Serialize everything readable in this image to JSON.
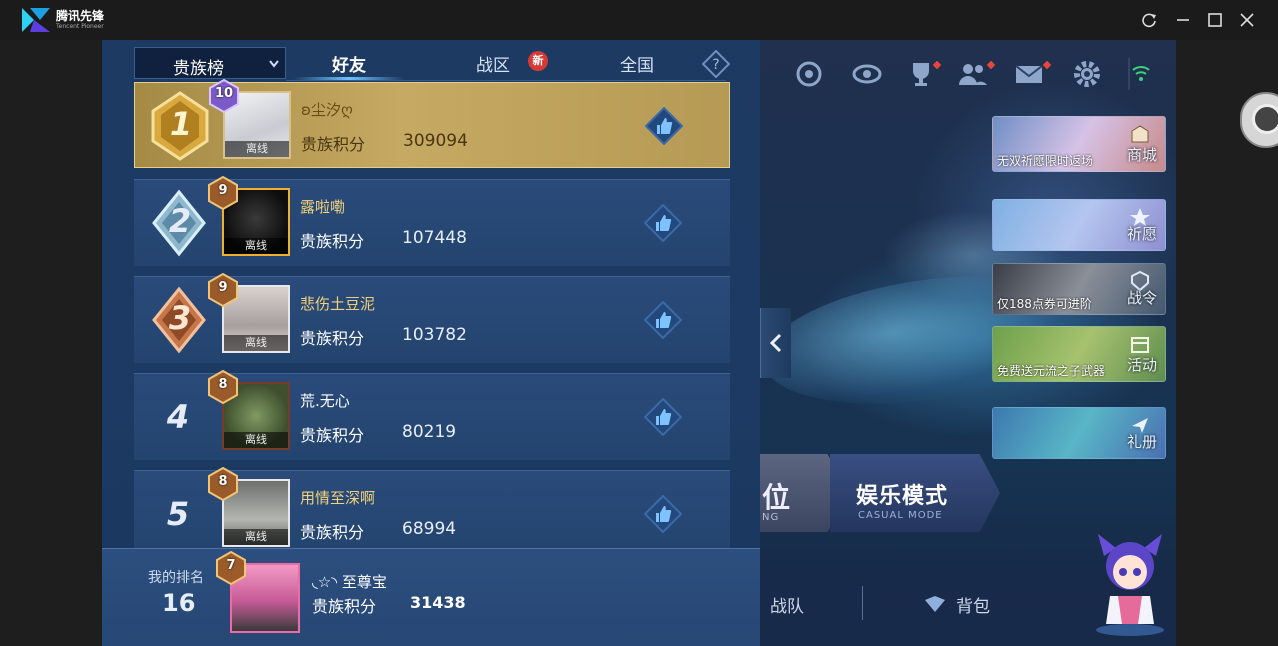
{
  "window": {
    "app_name": "腾讯先锋",
    "app_subtitle": "Tencent Pioneer",
    "buttons": [
      "refresh-icon",
      "minimize-icon",
      "maximize-icon",
      "close-icon"
    ]
  },
  "leaderboard": {
    "dropdown_label": "贵族榜",
    "tabs": [
      {
        "label": "好友",
        "active": true
      },
      {
        "label": "战区",
        "active": false,
        "badge": "新"
      },
      {
        "label": "全国",
        "active": false
      }
    ],
    "rows": [
      {
        "rank": "1",
        "level": "10",
        "name": "ʚ尘汐ღ",
        "status": "离线",
        "score_label": "贵族积分",
        "score": "309094"
      },
      {
        "rank": "2",
        "level": "9",
        "name": "露啦嘞",
        "status": "离线",
        "score_label": "贵族积分",
        "score": "107448"
      },
      {
        "rank": "3",
        "level": "9",
        "name": "悲伤土豆泥",
        "status": "离线",
        "score_label": "贵族积分",
        "score": "103782"
      },
      {
        "rank": "4",
        "level": "8",
        "name": "荒.无心",
        "status": "离线",
        "score_label": "贵族积分",
        "score": "80219"
      },
      {
        "rank": "5",
        "level": "8",
        "name": "用情至深啊",
        "status": "离线",
        "score_label": "贵族积分",
        "score": "68994"
      }
    ],
    "my_rank": {
      "label": "我的排名",
      "rank": "16",
      "level": "7",
      "name": "◟☆◝ 至尊宝",
      "score_label": "贵族积分",
      "score": "31438"
    }
  },
  "lobby": {
    "side_buttons": [
      {
        "caption": "无双祈愿限时返场",
        "label": "商城"
      },
      {
        "caption": "",
        "label": "祈愿"
      },
      {
        "caption": "仅188点券可进阶",
        "label": "战令"
      },
      {
        "caption": "免费送元流之子武器",
        "label": "活动"
      },
      {
        "caption": "",
        "label": "礼册"
      }
    ],
    "mode_ranked": {
      "label": "位",
      "sub": "NG"
    },
    "mode_casual": {
      "label": "娱乐模式",
      "sub": "CASUAL MODE"
    },
    "bottom": {
      "team": "战队",
      "bag": "背包"
    }
  },
  "colors": {
    "panel_bg": "#1c3a63",
    "gold_row": "#c6aa63",
    "name_gold": "#f1d27a"
  }
}
